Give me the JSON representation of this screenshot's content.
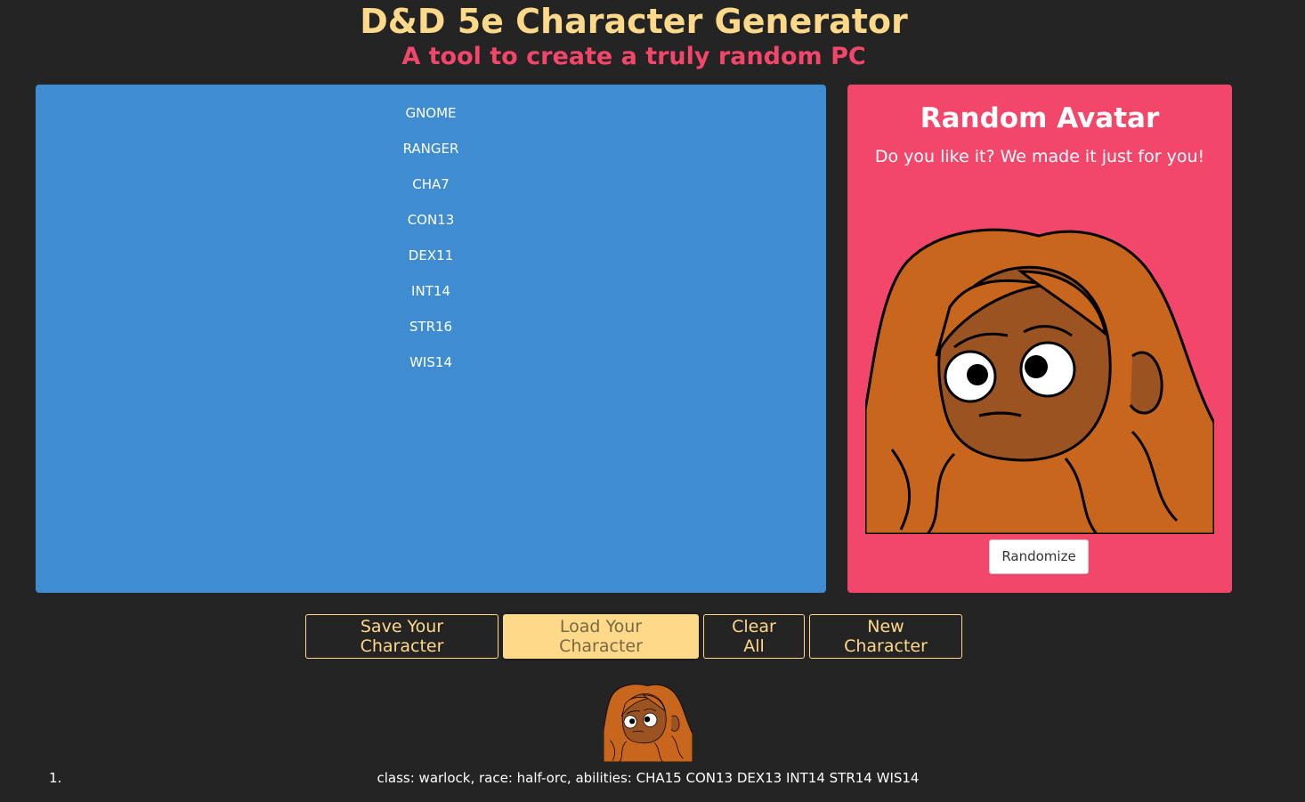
{
  "header": {
    "title": "D&D 5e Character Generator",
    "subtitle": "A tool to create a truly random PC"
  },
  "character": {
    "race": "GNOME",
    "class": "RANGER",
    "abilities": [
      "CHA7",
      "CON13",
      "DEX11",
      "INT14",
      "STR16",
      "WIS14"
    ]
  },
  "avatar": {
    "title": "Random Avatar",
    "subtitle": "Do you like it? We made it just for you!",
    "randomize_label": "Randomize"
  },
  "actions": {
    "save_label": "Save Your Character",
    "load_label": "Load Your Character",
    "clear_label": "Clear All",
    "new_label": "New Character"
  },
  "saved": [
    {
      "index": "1.",
      "text": "class: warlock, race: half-orc, abilities: CHA15 CON13 DEX13 INT14 STR14 WIS14"
    }
  ],
  "colors": {
    "background": "#242424",
    "gold": "#ffd98a",
    "pink": "#f2466a",
    "blue": "#3f8dd0",
    "hair": "#c8661e",
    "skin": "#9b5322"
  }
}
